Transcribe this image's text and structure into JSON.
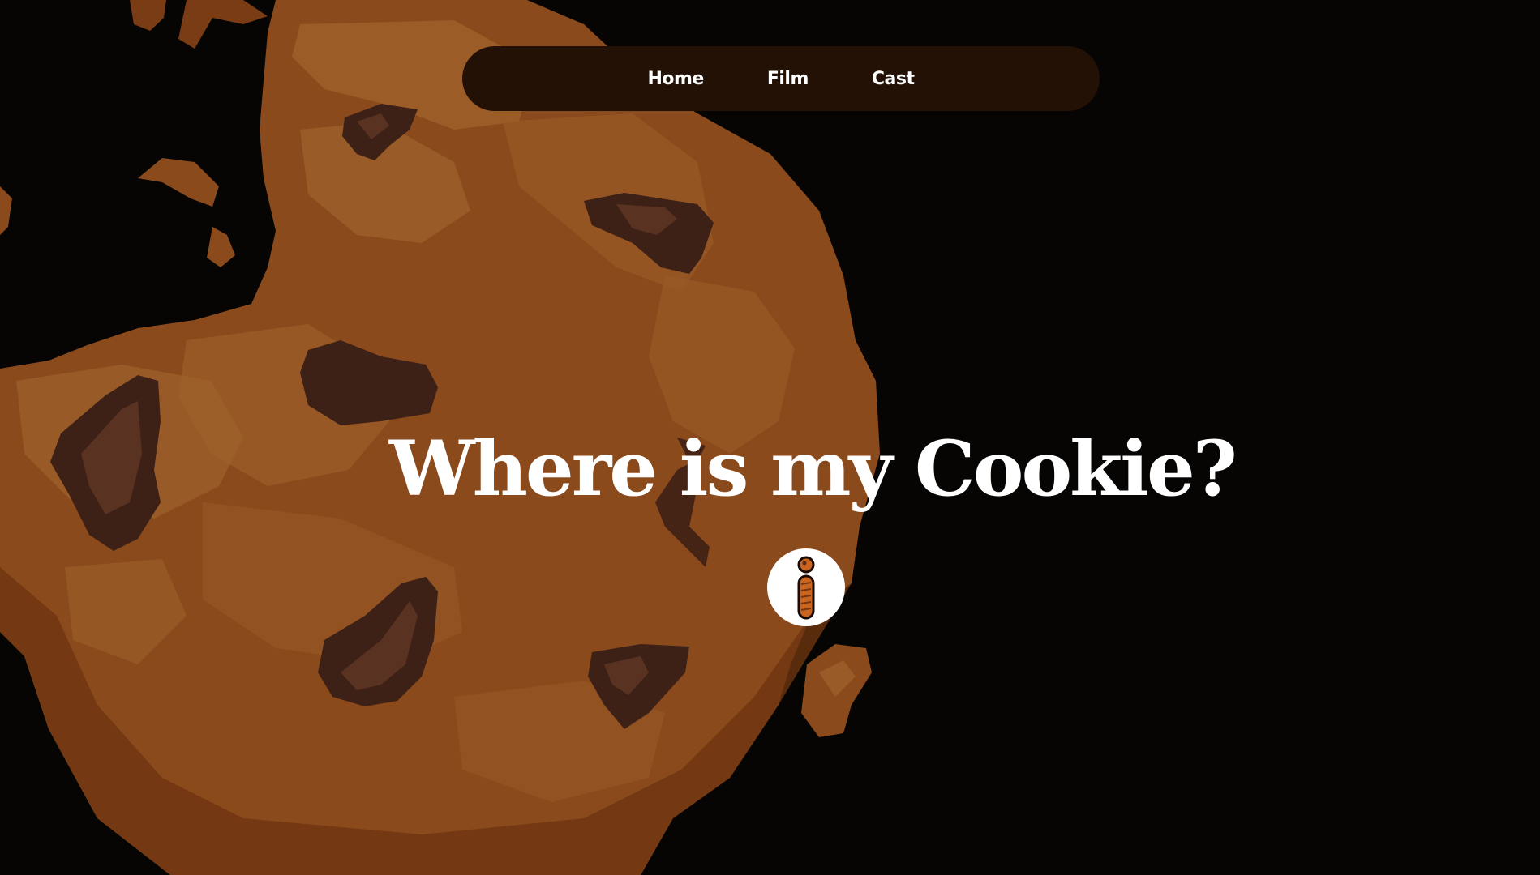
{
  "nav": {
    "items": [
      {
        "label": "Home"
      },
      {
        "label": "Film"
      },
      {
        "label": "Cast"
      }
    ]
  },
  "hero": {
    "title": "Where is my Cookie?"
  },
  "info_button": {
    "icon": "info-icon"
  },
  "background": {
    "illustration": "chocolate-chip-cookie",
    "colors": {
      "page": "#060504",
      "cookie_base": "#8a4a1c",
      "cookie_light": "#a0632c",
      "chip": "#3d2016",
      "nav": "#241106"
    }
  }
}
